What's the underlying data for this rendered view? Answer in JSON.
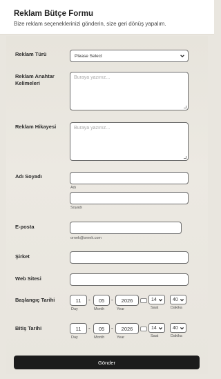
{
  "header": {
    "title": "Reklam Bütçe Formu",
    "subtitle": "Bize reklam seçeneklerinizi gönderin, size geri dönüş yapalım."
  },
  "fields": {
    "reklam_turu": {
      "label": "Reklam Türü",
      "value": "Please Select"
    },
    "anahtar": {
      "label": "Reklam Anahtar Kelimeleri",
      "placeholder": "Buraya yazınız..."
    },
    "hikaye": {
      "label": "Reklam Hikayesi",
      "placeholder": "Buraya yazınız..."
    },
    "ad_soyad": {
      "label": "Adı Soyadı",
      "first_sub": "Adı",
      "last_sub": "Soyadı"
    },
    "eposta": {
      "label": "E-posta",
      "sub": "ornek@ornek.com"
    },
    "sirket": {
      "label": "Şirket"
    },
    "web": {
      "label": "Web Sitesi"
    },
    "baslangic": {
      "label": "Başlangıç Tarihi",
      "day": "11",
      "month": "05",
      "year": "2026",
      "hour": "14",
      "minute": "40",
      "day_sub": "Day",
      "month_sub": "Month",
      "year_sub": "Year",
      "hour_sub": "Saat",
      "minute_sub": "Dakika"
    },
    "bitis": {
      "label": "Bitiş Tarihi",
      "day": "11",
      "month": "05",
      "year": "2026",
      "hour": "14",
      "minute": "40",
      "day_sub": "Day",
      "month_sub": "Month",
      "year_sub": "Year",
      "hour_sub": "Saat",
      "minute_sub": "Dakika"
    }
  },
  "date_separator": "-",
  "submit_label": "Gönder"
}
